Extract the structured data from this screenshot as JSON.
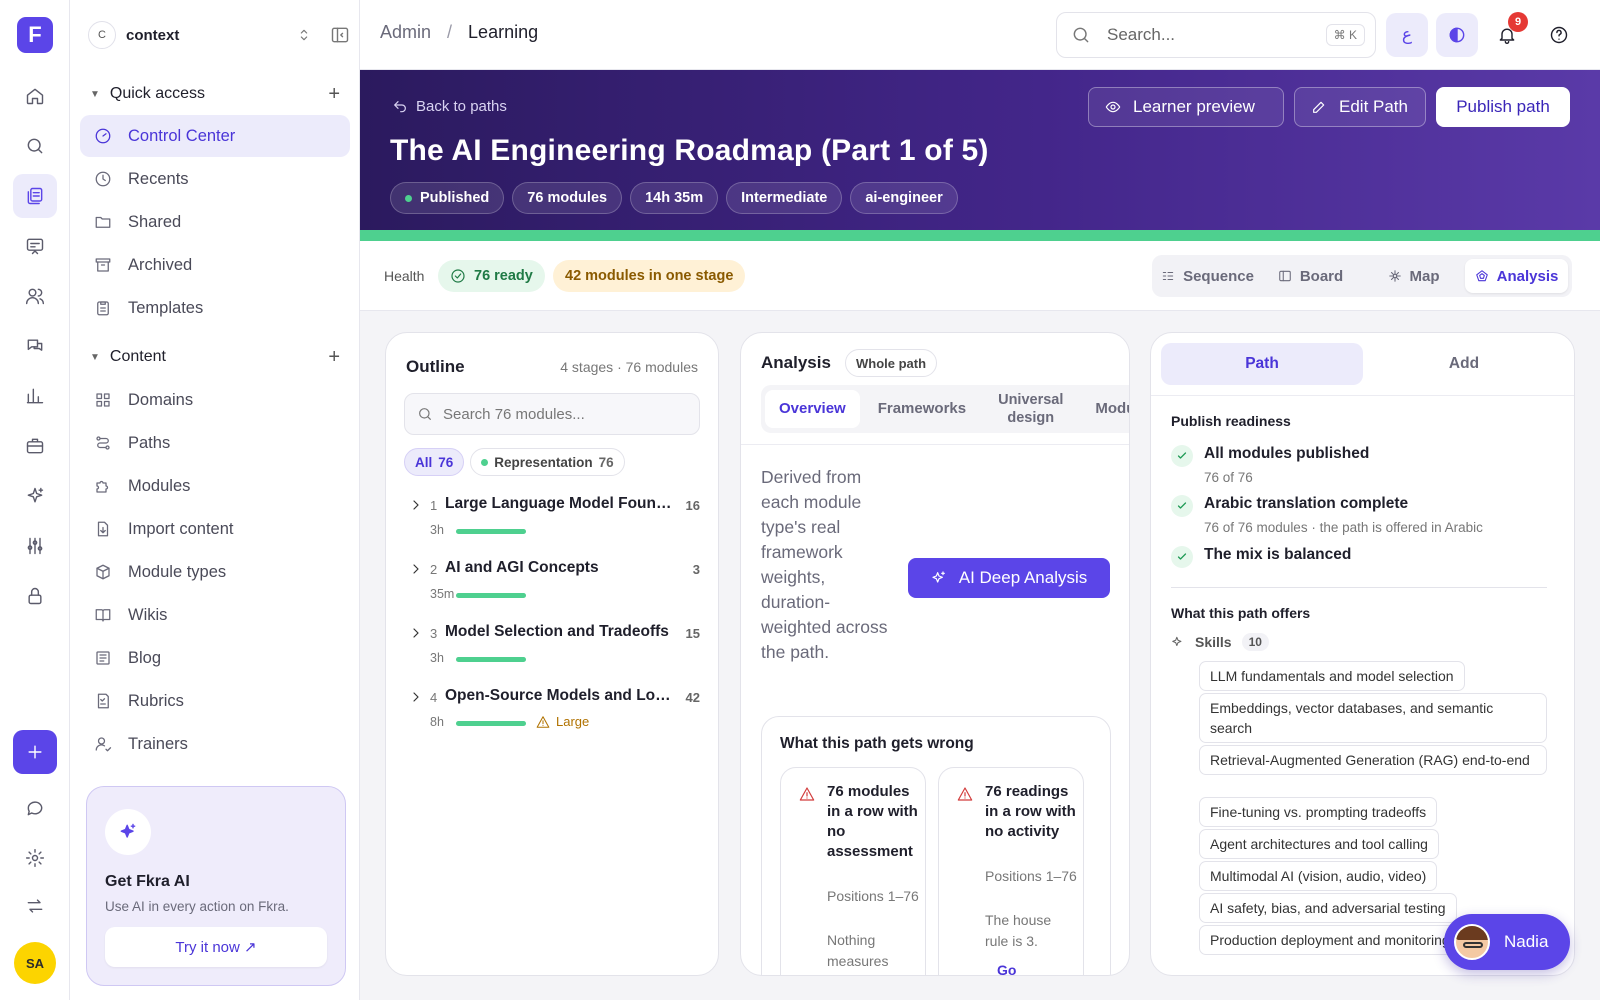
{
  "brand": {
    "logo_letter": "F",
    "accent": "#5b45e8"
  },
  "user": {
    "initials": "SA"
  },
  "workspace": {
    "badge": "C",
    "name": "context"
  },
  "sidebar": {
    "quick_access_label": "Quick access",
    "quick_items": [
      {
        "label": "Control Center",
        "icon": "gauge-icon"
      },
      {
        "label": "Recents",
        "icon": "clock-icon"
      },
      {
        "label": "Shared",
        "icon": "shared-folder-icon"
      },
      {
        "label": "Archived",
        "icon": "archive-icon"
      },
      {
        "label": "Templates",
        "icon": "clipboard-icon"
      }
    ],
    "content_label": "Content",
    "content_items": [
      {
        "label": "Domains",
        "icon": "grid-icon"
      },
      {
        "label": "Paths",
        "icon": "route-icon"
      },
      {
        "label": "Modules",
        "icon": "puzzle-icon"
      },
      {
        "label": "Import content",
        "icon": "import-icon"
      },
      {
        "label": "Module types",
        "icon": "cube-icon"
      },
      {
        "label": "Wikis",
        "icon": "book-icon"
      },
      {
        "label": "Blog",
        "icon": "newspaper-icon"
      },
      {
        "label": "Rubrics",
        "icon": "checklist-icon"
      },
      {
        "label": "Trainers",
        "icon": "person-icon"
      }
    ],
    "ai_card": {
      "title": "Get Fkra AI",
      "subtitle": "Use AI in every action on Fkra.",
      "button": "Try it now ↗"
    }
  },
  "topbar": {
    "breadcrumb_root": "Admin",
    "breadcrumb_sep": "/",
    "breadcrumb_current": "Learning",
    "search_placeholder": "Search...",
    "search_shortcut": "⌘ K",
    "lang_label": "ع",
    "notification_count": "9"
  },
  "hero": {
    "back_label": "Back to paths",
    "title": "The AI Engineering Roadmap (Part 1 of 5)",
    "status": "Published",
    "chips": [
      "76 modules",
      "14h 35m",
      "Intermediate",
      "ai-engineer"
    ],
    "learner_preview": "Learner preview",
    "edit_path": "Edit Path",
    "publish_path": "Publish path"
  },
  "health": {
    "label": "Health",
    "ready": "76 ready",
    "warning": "42 modules in one stage",
    "views": [
      "Sequence",
      "Board",
      "Map",
      "Analysis"
    ],
    "active_view": "Analysis"
  },
  "outline": {
    "title": "Outline",
    "meta": "4 stages · 76 modules",
    "search_placeholder": "Search 76 modules...",
    "filters": [
      {
        "label": "All",
        "count": "76"
      },
      {
        "label": "Representation",
        "count": "76"
      }
    ],
    "stages": [
      {
        "num": "1",
        "name": "Large Language Model Foundations",
        "count": "16",
        "duration": "3h",
        "progress": 1.0,
        "flag": ""
      },
      {
        "num": "2",
        "name": "AI and AGI Concepts",
        "count": "3",
        "duration": "35m",
        "progress": 1.0,
        "flag": ""
      },
      {
        "num": "3",
        "name": "Model Selection and Tradeoffs",
        "count": "15",
        "duration": "3h",
        "progress": 1.0,
        "flag": ""
      },
      {
        "num": "4",
        "name": "Open-Source Models and Local Inference",
        "count": "42",
        "duration": "8h",
        "progress": 1.0,
        "flag": "Large"
      }
    ]
  },
  "analysis": {
    "title": "Analysis",
    "scope": "Whole path",
    "tabs": [
      "Overview",
      "Frameworks",
      "Universal design",
      "Modules"
    ],
    "description": "Derived from each module type's real framework weights, duration-weighted across the path.",
    "ai_button": "AI Deep Analysis",
    "wrong_title": "What this path gets wrong",
    "issues": [
      {
        "title": "76 modules in a row with no assessment",
        "positions": "Positions 1–76",
        "note": "Nothing measures"
      },
      {
        "title": "76 readings in a row with no activity",
        "positions": "Positions 1–76",
        "note": "The house rule is 3.",
        "action": "Go"
      }
    ]
  },
  "side_panel": {
    "tabs": [
      "Path",
      "Add"
    ],
    "readiness_title": "Publish readiness",
    "checks": [
      {
        "title": "All modules published",
        "sub": "76 of 76"
      },
      {
        "title": "Arabic translation complete",
        "sub": "76 of 76 modules · the path is offered in Arabic"
      },
      {
        "title": "The mix is balanced",
        "sub": ""
      }
    ],
    "offers_title": "What this path offers",
    "skills_label": "Skills",
    "skills_count": "10",
    "skills": [
      "LLM fundamentals and model selection",
      "Embeddings, vector databases, and semantic search",
      "Retrieval-Augmented Generation (RAG) end-to-end",
      "Fine-tuning vs. prompting tradeoffs",
      "Agent architectures and tool calling",
      "Multimodal AI (vision, audio, video)",
      "AI safety, bias, and adversarial testing",
      "Production deployment and monitoring"
    ]
  },
  "assistant": {
    "name": "Nadia"
  }
}
